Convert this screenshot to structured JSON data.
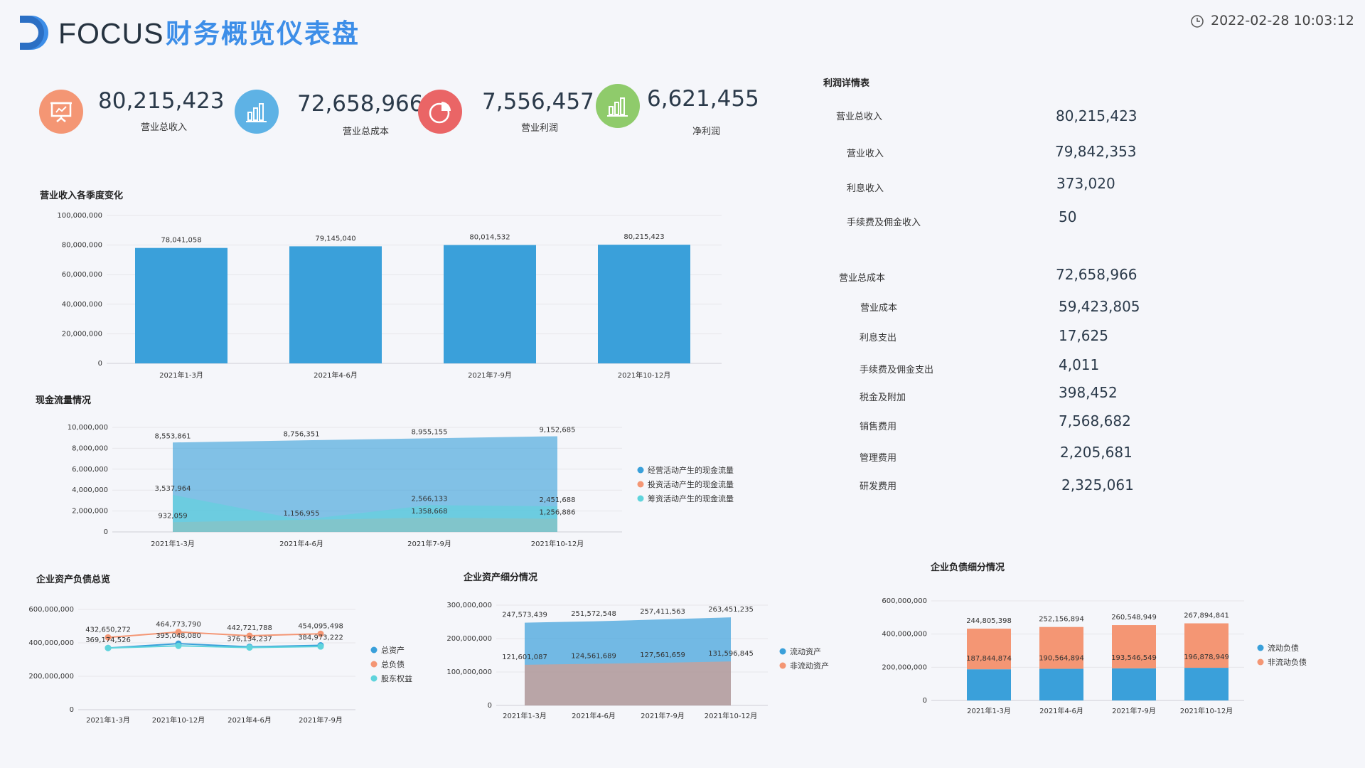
{
  "header": {
    "logo_text": "FOCUS",
    "title": "财务概览仪表盘",
    "datetime": "2022-02-28 10:03:12",
    "logo_icon": "focus-logo",
    "clock_icon": "clock-icon"
  },
  "colors": {
    "blue": "#3aa0da",
    "orange": "#f49674",
    "cyan": "#5fd4dc",
    "kpi1": "#f49674",
    "kpi2": "#5eb2e5",
    "kpi3": "#ea6566",
    "kpi4": "#8fcb6b"
  },
  "kpis": [
    {
      "value": "80,215,423",
      "label": "营业总收入",
      "icon": "presentation-icon"
    },
    {
      "value": "72,658,966",
      "label": "营业总成本",
      "icon": "bar-chart-icon"
    },
    {
      "value": "7,556,457",
      "label": "营业利润",
      "icon": "pie-chart-icon"
    },
    {
      "value": "6,621,455",
      "label": "净利润",
      "icon": "bar-chart-icon"
    }
  ],
  "profit_table": {
    "title": "利润详情表",
    "rows": [
      {
        "label": "营业总收入",
        "value": "80,215,423"
      },
      {
        "label": "营业收入",
        "value": "79,842,353"
      },
      {
        "label": "利息收入",
        "value": "373,020"
      },
      {
        "label": "手续费及佣金收入",
        "value": "50"
      },
      {
        "label": "营业总成本",
        "value": "72,658,966"
      },
      {
        "label": "营业成本",
        "value": "59,423,805"
      },
      {
        "label": "利息支出",
        "value": "17,625"
      },
      {
        "label": "手续费及佣金支出",
        "value": "4,011"
      },
      {
        "label": "税金及附加",
        "value": "398,452"
      },
      {
        "label": "销售费用",
        "value": "7,568,682"
      },
      {
        "label": "管理费用",
        "value": "2,205,681"
      },
      {
        "label": "研发费用",
        "value": "2,325,061"
      }
    ]
  },
  "chart_data": [
    {
      "id": "revenue",
      "type": "bar",
      "title": "营业收入各季度变化",
      "categories": [
        "2021年1-3月",
        "2021年4-6月",
        "2021年7-9月",
        "2021年10-12月"
      ],
      "values": [
        78041058,
        79145040,
        80014532,
        80215423
      ],
      "data_labels": [
        "78,041,058",
        "79,145,040",
        "80,014,532",
        "80,215,423"
      ],
      "yticks": [
        "0",
        "20,000,000",
        "40,000,000",
        "60,000,000",
        "80,000,000",
        "100,000,000"
      ],
      "ylim": [
        0,
        100000000
      ],
      "grid": true
    },
    {
      "id": "cashflow",
      "type": "area",
      "title": "现金流量情况",
      "categories": [
        "2021年1-3月",
        "2021年4-6月",
        "2021年7-9月",
        "2021年10-12月"
      ],
      "series": [
        {
          "name": "经营活动产生的现金流量",
          "values": [
            8553861,
            8756351,
            8955155,
            9152685
          ],
          "labels": [
            "8,553,861",
            "8,756,351",
            "8,955,155",
            "9,152,685"
          ]
        },
        {
          "name": "投资活动产生的现金流量",
          "values": [
            932059,
            1156955,
            1358668,
            1256886
          ],
          "labels": [
            "932,059",
            "1,156,955",
            "1,358,668",
            "1,256,886"
          ]
        },
        {
          "name": "筹资活动产生的现金流量",
          "values": [
            3537964,
            1156955,
            2566133,
            2451688
          ],
          "labels": [
            "3,537,964",
            "",
            "2,566,133",
            "2,451,688"
          ]
        }
      ],
      "yticks": [
        "0",
        "2,000,000",
        "4,000,000",
        "6,000,000",
        "8,000,000",
        "10,000,000"
      ],
      "ylim": [
        0,
        10000000
      ],
      "legend": "right",
      "grid": true
    },
    {
      "id": "assets_total",
      "type": "line",
      "title": "企业资产负债总览",
      "categories": [
        "2021年1-3月",
        "2021年10-12月",
        "2021年4-6月",
        "2021年7-9月"
      ],
      "series": [
        {
          "name": "总资产",
          "values": [
            369174526,
            395048080,
            376134237,
            384973222
          ],
          "labels": [
            "369,174,526",
            "395,048,080",
            "376,134,237",
            "384,973,222"
          ]
        },
        {
          "name": "总负债",
          "values": [
            432650272,
            464773790,
            442721788,
            454095498
          ],
          "labels": [
            "432,650,272",
            "464,773,790",
            "442,721,788",
            "454,095,498"
          ]
        },
        {
          "name": "股东权益",
          "values": [
            369174526,
            382000000,
            372000000,
            378000000
          ],
          "labels": [
            "",
            "",
            "",
            ""
          ]
        }
      ],
      "yticks": [
        "0",
        "200,000,000",
        "400,000,000",
        "600,000,000"
      ],
      "ylim": [
        0,
        600000000
      ],
      "legend": "right",
      "grid": true
    },
    {
      "id": "assets_detail",
      "type": "area",
      "title": "企业资产细分情况",
      "categories": [
        "2021年1-3月",
        "2021年4-6月",
        "2021年7-9月",
        "2021年10-12月"
      ],
      "series": [
        {
          "name": "流动资产",
          "values": [
            247573439,
            251572548,
            257411563,
            263451235
          ],
          "labels": [
            "247,573,439",
            "251,572,548",
            "257,411,563",
            "263,451,235"
          ]
        },
        {
          "name": "非流动资产",
          "values": [
            121601087,
            124561689,
            127561659,
            131596845
          ],
          "labels": [
            "121,601,087",
            "124,561,689",
            "127,561,659",
            "131,596,845"
          ]
        }
      ],
      "yticks": [
        "0",
        "100,000,000",
        "200,000,000",
        "300,000,000"
      ],
      "ylim": [
        0,
        300000000
      ],
      "legend": "right",
      "grid": true
    },
    {
      "id": "liabilities",
      "type": "bar",
      "stacked": true,
      "title": "企业负债细分情况",
      "categories": [
        "2021年1-3月",
        "2021年4-6月",
        "2021年7-9月",
        "2021年10-12月"
      ],
      "series": [
        {
          "name": "流动负债",
          "values": [
            187844874,
            190564894,
            193546549,
            196878949
          ],
          "labels": [
            "187,844,874",
            "190,564,894",
            "193,546,549",
            "196,878,949"
          ]
        },
        {
          "name": "非流动负债",
          "values": [
            244805398,
            252156894,
            260548949,
            267894841
          ],
          "labels": [
            "244,805,398",
            "252,156,894",
            "260,548,949",
            "267,894,841"
          ]
        }
      ],
      "yticks": [
        "0",
        "200,000,000",
        "400,000,000",
        "600,000,000"
      ],
      "ylim": [
        0,
        600000000
      ],
      "legend": "right",
      "grid": true
    }
  ]
}
